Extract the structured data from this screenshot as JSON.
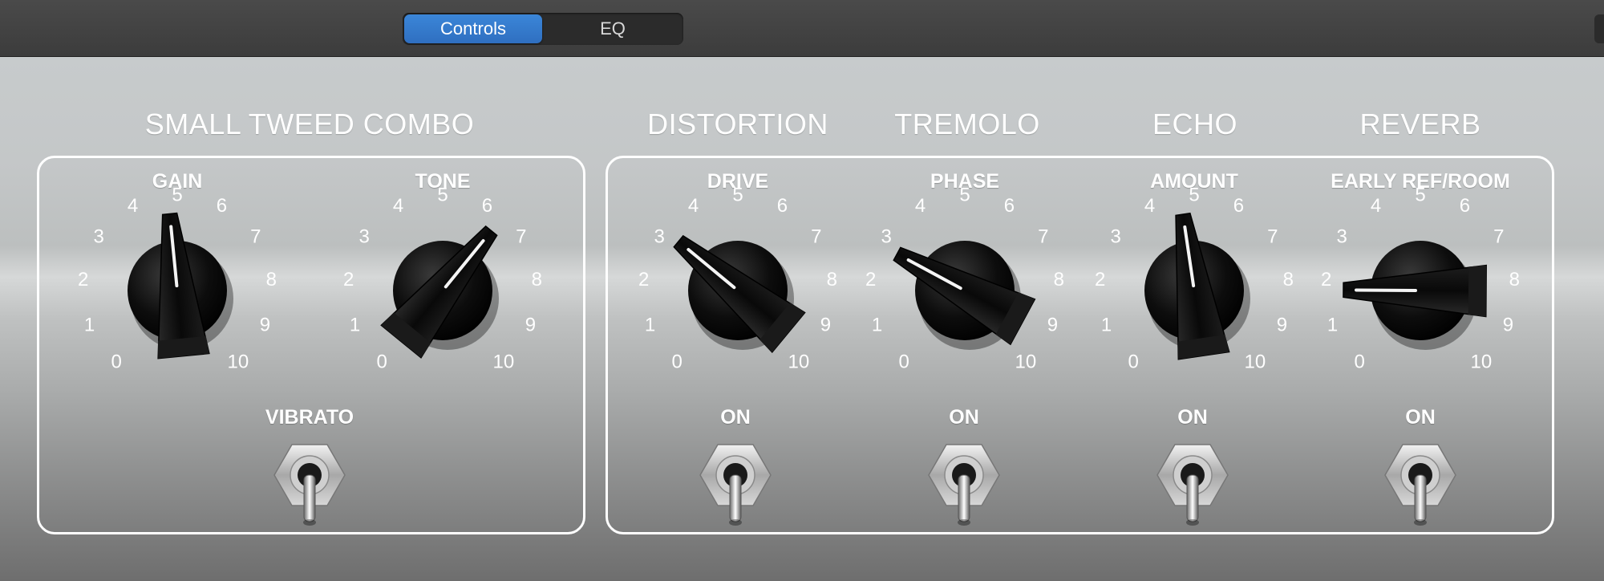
{
  "tabs": [
    {
      "label": "Controls",
      "active": true
    },
    {
      "label": "EQ",
      "active": false
    }
  ],
  "sections": {
    "amp": "SMALL TWEED COMBO",
    "distortion": "DISTORTION",
    "tremolo": "TREMOLO",
    "echo": "ECHO",
    "reverb": "REVERB"
  },
  "knobs": [
    {
      "id": "gain",
      "label": "GAIN",
      "value": 4.8
    },
    {
      "id": "tone",
      "label": "TONE",
      "value": 6.4
    },
    {
      "id": "drive",
      "label": "DRIVE",
      "value": 3.2
    },
    {
      "id": "phase",
      "label": "PHASE",
      "value": 2.8
    },
    {
      "id": "amount",
      "label": "AMOUNT",
      "value": 4.7
    },
    {
      "id": "early-ref-room",
      "label": "EARLY REF/ROOM",
      "value": 1.8
    }
  ],
  "scale": [
    "0",
    "1",
    "2",
    "3",
    "4",
    "5",
    "6",
    "7",
    "8",
    "9",
    "10"
  ],
  "switches": [
    {
      "id": "vibrato",
      "label": "VIBRATO"
    },
    {
      "id": "distortion",
      "label": "ON"
    },
    {
      "id": "tremolo",
      "label": "ON"
    },
    {
      "id": "echo",
      "label": "ON"
    },
    {
      "id": "reverb",
      "label": "ON"
    }
  ],
  "colors": {
    "accent": "#2f74c8",
    "label": "#ffffff",
    "knob": "#0a0a0a"
  }
}
